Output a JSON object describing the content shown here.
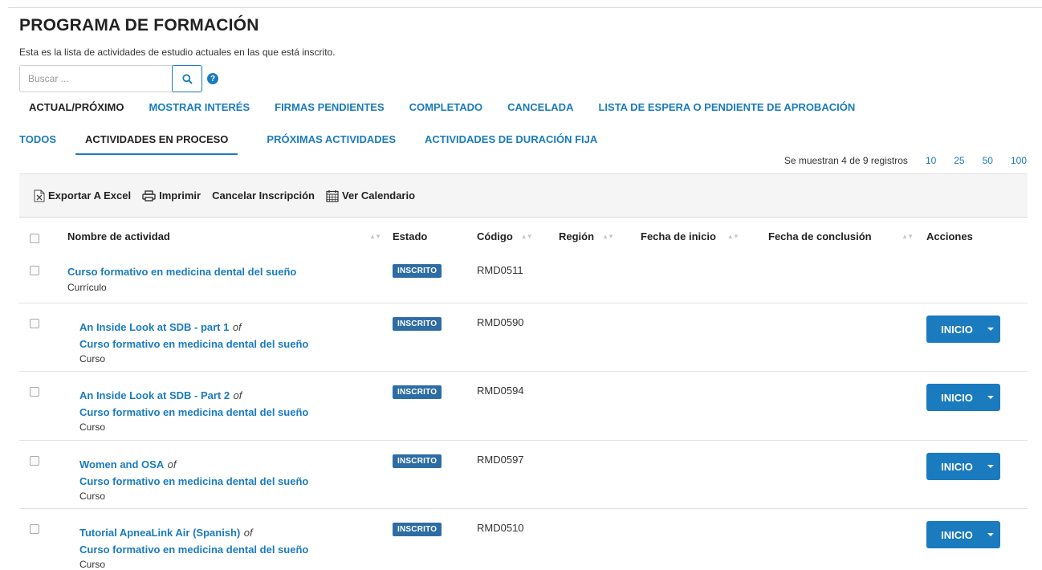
{
  "page": {
    "title": "PROGRAMA DE FORMACIÓN",
    "subtitle": "Esta es la lista de actividades de estudio actuales en las que está inscrito."
  },
  "search": {
    "placeholder": "Buscar ...",
    "value": ""
  },
  "tabs_primary": [
    {
      "label": "ACTUAL/PRÓXIMO",
      "active": true
    },
    {
      "label": "MOSTRAR INTERÉS",
      "active": false
    },
    {
      "label": "FIRMAS PENDIENTES",
      "active": false
    },
    {
      "label": "COMPLETADO",
      "active": false
    },
    {
      "label": "CANCELADA",
      "active": false
    },
    {
      "label": "LISTA DE ESPERA O PENDIENTE DE APROBACIÓN",
      "active": false
    }
  ],
  "tabs_secondary": [
    {
      "label": "TODOS",
      "active": false
    },
    {
      "label": "ACTIVIDADES EN PROCESO",
      "active": true
    },
    {
      "label": "PRÓXIMAS ACTIVIDADES",
      "active": false
    },
    {
      "label": "ACTIVIDADES DE DURACIÓN FIJA",
      "active": false
    }
  ],
  "records": {
    "text": "Se muestran 4 de 9 registros",
    "page_sizes": [
      "10",
      "25",
      "50",
      "100"
    ]
  },
  "toolbar": {
    "export": "Exportar A Excel",
    "print": "Imprimir",
    "cancel": "Cancelar Inscripción",
    "calendar": "Ver Calendario"
  },
  "table": {
    "headers": {
      "name": "Nombre de actividad",
      "status": "Estado",
      "code": "Código",
      "region": "Región",
      "start": "Fecha de inicio",
      "end": "Fecha de conclusión",
      "actions": "Acciones"
    },
    "rows": [
      {
        "name": "Curso formativo en medicina dental del sueño",
        "of": "",
        "parent": "",
        "type": "Currículo",
        "status": "INSCRITO",
        "code": "RMD0511",
        "action": ""
      },
      {
        "name": "An Inside Look at SDB - part 1",
        "of": "of",
        "parent": "Curso formativo en medicina dental del sueño",
        "type": "Curso",
        "status": "INSCRITO",
        "code": "RMD0590",
        "action": "INICIO"
      },
      {
        "name": "An Inside Look at SDB - Part 2",
        "of": "of",
        "parent": "Curso formativo en medicina dental del sueño",
        "type": "Curso",
        "status": "INSCRITO",
        "code": "RMD0594",
        "action": "INICIO"
      },
      {
        "name": "Women and OSA",
        "of": "of",
        "parent": "Curso formativo en medicina dental del sueño",
        "type": "Curso",
        "status": "INSCRITO",
        "code": "RMD0597",
        "action": "INICIO"
      },
      {
        "name": "Tutorial ApneaLink Air (Spanish)",
        "of": "of",
        "parent": "Curso formativo en medicina dental del sueño",
        "type": "Curso",
        "status": "INSCRITO",
        "code": "RMD0510",
        "action": "INICIO"
      }
    ]
  },
  "colors": {
    "accent": "#1a7bbf",
    "badge": "#2e6da4"
  }
}
